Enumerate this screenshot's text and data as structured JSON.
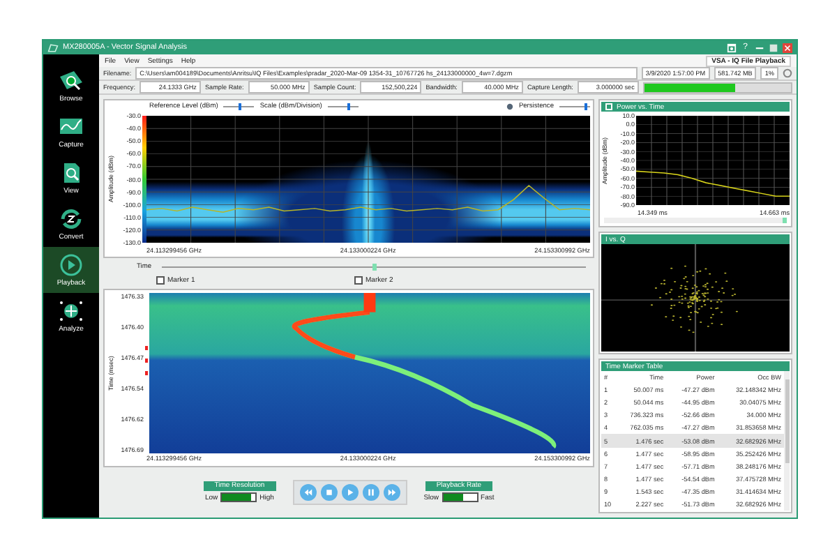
{
  "window": {
    "title": "MX280005A - Vector Signal Analysis",
    "help": "?"
  },
  "sidebar": {
    "items": [
      {
        "label": "Browse",
        "kind": "browse",
        "selected": false
      },
      {
        "label": "Capture",
        "kind": "capture",
        "selected": false
      },
      {
        "label": "View",
        "kind": "view",
        "selected": false
      },
      {
        "label": "Convert",
        "kind": "convert",
        "selected": false
      },
      {
        "label": "Playback",
        "kind": "playback",
        "selected": true
      },
      {
        "label": "Analyze",
        "kind": "analyze",
        "selected": false
      }
    ]
  },
  "menu": [
    "File",
    "View",
    "Settings",
    "Help"
  ],
  "mode_label": "VSA - IQ File Playback",
  "file_info": {
    "filename_label": "Filename:",
    "filename": "C:\\Users\\am004189\\Documents\\Anritsu\\IQ Files\\Examples\\pradar_2020-Mar-09 1354-31_10767726 hs_24133000000_4w=7.dgzm",
    "date": "3/9/2020 1:57:00 PM",
    "size": "581.742 MB",
    "percent": "1%"
  },
  "capture_info": {
    "fields": [
      {
        "label": "Frequency:",
        "value": "24.1333 GHz"
      },
      {
        "label": "Sample Rate:",
        "value": "50.000 MHz"
      },
      {
        "label": "Sample Count:",
        "value": "152,500,224"
      },
      {
        "label": "Bandwidth:",
        "value": "40.000 MHz"
      },
      {
        "label": "Capture Length:",
        "value": "3.000000 sec"
      }
    ],
    "progress": {
      "level": 0.62
    }
  },
  "spectrum": {
    "controls": [
      {
        "label": "Reference Level (dBm)",
        "level": 0.55
      },
      {
        "label": "Scale (dBm/Division)",
        "level": 0.7
      },
      {
        "label": "Persistence",
        "level": 0.85
      }
    ],
    "chart_data": {
      "type": "line",
      "grid": true,
      "ylabel": "Amplitude (dBm)",
      "ylim": [
        -130,
        -30
      ],
      "yticks": [
        {
          "value": -30,
          "label": "-30.0"
        },
        {
          "value": -40,
          "label": "-40.0"
        },
        {
          "value": -50,
          "label": "-50.0"
        },
        {
          "value": -60,
          "label": "-60.0"
        },
        {
          "value": -70,
          "label": "-70.0"
        },
        {
          "value": -80,
          "label": "-80.0"
        },
        {
          "value": -90,
          "label": "-90.0"
        },
        {
          "value": -100,
          "label": "-100.0"
        },
        {
          "value": -110,
          "label": "-110.0"
        },
        {
          "value": -120,
          "label": "-120.0"
        },
        {
          "value": -130,
          "label": "-130.0"
        }
      ],
      "series": [
        {
          "color": "#b8b526",
          "values": [
            -104,
            -103,
            -105,
            -102,
            -104,
            -106,
            -103,
            -104,
            -102,
            -105,
            -104,
            -103,
            -105,
            -104,
            -102,
            -104,
            -103,
            -105,
            -104,
            -103,
            -104,
            -102,
            -105,
            -104,
            -96,
            -85,
            -95,
            -104,
            -103,
            -104
          ]
        }
      ]
    },
    "x_labels": [
      "24.113299456 GHz",
      "24.133000224 GHz",
      "24.153300992 GHz"
    ]
  },
  "time_slider": {
    "label": "Time",
    "level": 0.5
  },
  "markers": [
    {
      "label": "Marker 1",
      "checked": false
    },
    {
      "label": "Marker 2",
      "checked": false
    }
  ],
  "spectrogram": {
    "y_label": "Time (msec)",
    "y_ticks": [
      "1476.33",
      "1476.40",
      "1476.47",
      "1476.54",
      "1476.62",
      "1476.69"
    ],
    "x_labels": [
      "24.113299456 GHz",
      "24.133000224 GHz",
      "24.153300992 GHz"
    ]
  },
  "time_resolution": {
    "title": "Time Resolution",
    "low": "Low",
    "high": "High",
    "level": 0.85
  },
  "playback_buttons": [
    {
      "kind": "rewind"
    },
    {
      "kind": "stop"
    },
    {
      "kind": "play"
    },
    {
      "kind": "pause"
    },
    {
      "kind": "forward"
    }
  ],
  "playback_rate": {
    "title": "Playback Rate",
    "low": "Slow",
    "high": "Fast",
    "level": 0.6
  },
  "power_vs_time": {
    "title": "Power vs. Time",
    "chart_data": {
      "type": "line",
      "grid": true,
      "ylabel": "Amplitude (dBm)",
      "ylim": [
        -90,
        10
      ],
      "yticks": [
        {
          "value": 10,
          "label": "10.0"
        },
        {
          "value": 0,
          "label": "0.0"
        },
        {
          "value": -10,
          "label": "-10.0"
        },
        {
          "value": -20,
          "label": "-20.0"
        },
        {
          "value": -30,
          "label": "-30.0"
        },
        {
          "value": -40,
          "label": "-40.0"
        },
        {
          "value": -50,
          "label": "-50.0"
        },
        {
          "value": -60,
          "label": "-60.0"
        },
        {
          "value": -70,
          "label": "-70.0"
        },
        {
          "value": -80,
          "label": "-80.0"
        },
        {
          "value": -90,
          "label": "-90.0"
        }
      ],
      "series": [
        {
          "color": "#d6d21a",
          "values": [
            -52,
            -53,
            -54,
            -56,
            -60,
            -65,
            -68,
            -71,
            -74,
            -77,
            -80,
            -80
          ]
        }
      ]
    },
    "x_labels": [
      "14.349 ms",
      "14.663 ms"
    ]
  },
  "iq_plot": {
    "title": "I vs. Q"
  },
  "marker_table": {
    "title": "Time Marker Table",
    "columns": [
      "#",
      "Time",
      "Power",
      "Occ BW"
    ],
    "rows": [
      {
        "cells": [
          "1",
          "50.007 ms",
          "-47.27 dBm",
          "32.148342 MHz"
        ],
        "selected": false
      },
      {
        "cells": [
          "2",
          "50.044 ms",
          "-44.95 dBm",
          "30.04075 MHz"
        ],
        "selected": false
      },
      {
        "cells": [
          "3",
          "736.323 ms",
          "-52.66 dBm",
          "34.000 MHz"
        ],
        "selected": false
      },
      {
        "cells": [
          "4",
          "762.035 ms",
          "-47.27 dBm",
          "31.853658 MHz"
        ],
        "selected": false
      },
      {
        "cells": [
          "5",
          "1.476 sec",
          "-53.08 dBm",
          "32.682926 MHz"
        ],
        "selected": true
      },
      {
        "cells": [
          "6",
          "1.477 sec",
          "-58.95 dBm",
          "35.252426 MHz"
        ],
        "selected": false
      },
      {
        "cells": [
          "7",
          "1.477 sec",
          "-57.71 dBm",
          "38.248176 MHz"
        ],
        "selected": false
      },
      {
        "cells": [
          "8",
          "1.477 sec",
          "-54.54 dBm",
          "37.475728 MHz"
        ],
        "selected": false
      },
      {
        "cells": [
          "9",
          "1.543 sec",
          "-47.35 dBm",
          "31.414634 MHz"
        ],
        "selected": false
      },
      {
        "cells": [
          "10",
          "2.227 sec",
          "-51.73 dBm",
          "32.682926 MHz"
        ],
        "selected": false
      }
    ]
  }
}
